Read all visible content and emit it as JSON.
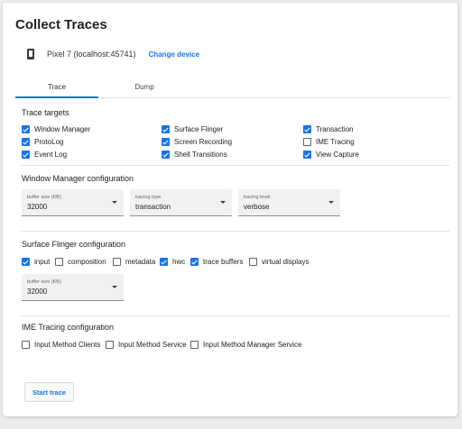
{
  "page": {
    "title": "Collect Traces",
    "device_name": "Pixel 7 (localhost:45741)",
    "change_device": "Change device",
    "icon": "smartphone-icon"
  },
  "tabs": [
    {
      "label": "Trace",
      "active": true
    },
    {
      "label": "Dump",
      "active": false
    }
  ],
  "trace_targets": {
    "title": "Trace targets",
    "items": [
      {
        "label": "Window Manager",
        "checked": true
      },
      {
        "label": "ProtoLog",
        "checked": true
      },
      {
        "label": "Event Log",
        "checked": true
      },
      {
        "label": "Surface Flinger",
        "checked": true
      },
      {
        "label": "Screen Recording",
        "checked": true
      },
      {
        "label": "Shell Transitions",
        "checked": true
      },
      {
        "label": "Transaction",
        "checked": true
      },
      {
        "label": "IME Tracing",
        "checked": false
      },
      {
        "label": "View Capture",
        "checked": true
      }
    ]
  },
  "wm_config": {
    "title": "Window Manager configuration",
    "fields": [
      {
        "label": "buffer size (KB)",
        "value": "32000"
      },
      {
        "label": "tracing type",
        "value": "transaction"
      },
      {
        "label": "tracing level",
        "value": "verbose"
      }
    ]
  },
  "sf_config": {
    "title": "Surface Flinger configuration",
    "options": [
      {
        "label": "input",
        "checked": true
      },
      {
        "label": "composition",
        "checked": false
      },
      {
        "label": "metadata",
        "checked": false
      },
      {
        "label": "hwc",
        "checked": true
      },
      {
        "label": "trace buffers",
        "checked": true
      },
      {
        "label": "virtual displays",
        "checked": false
      }
    ],
    "buffer": {
      "label": "buffer size (KB)",
      "value": "32000"
    }
  },
  "ime_config": {
    "title": "IME Tracing configuration",
    "options": [
      {
        "label": "Input Method Clients",
        "checked": false
      },
      {
        "label": "Input Method Service",
        "checked": false
      },
      {
        "label": "Input Method Manager Service",
        "checked": false
      }
    ]
  },
  "start_button": "Start trace",
  "colors": {
    "accent": "#1a73e8",
    "background": "#ececec",
    "card": "#ffffff"
  }
}
